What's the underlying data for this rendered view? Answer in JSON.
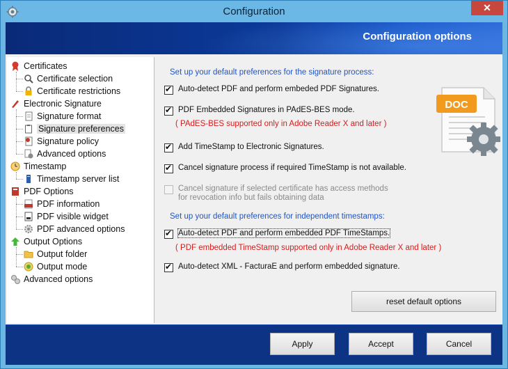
{
  "window": {
    "title": "Configuration"
  },
  "banner": {
    "title": "Configuration options"
  },
  "tree": {
    "items": [
      {
        "label": "Certificates",
        "level": 0,
        "icon": "ribbon-icon"
      },
      {
        "label": "Certificate selection",
        "level": 1,
        "icon": "magnifier-icon"
      },
      {
        "label": "Certificate restrictions",
        "level": 1,
        "icon": "lock-icon"
      },
      {
        "label": "Electronic Signature",
        "level": 0,
        "icon": "pen-icon"
      },
      {
        "label": "Signature format",
        "level": 1,
        "icon": "document-icon"
      },
      {
        "label": "Signature preferences",
        "level": 1,
        "icon": "clipboard-icon",
        "selected": true
      },
      {
        "label": "Signature policy",
        "level": 1,
        "icon": "policy-icon"
      },
      {
        "label": "Advanced options",
        "level": 1,
        "icon": "gear-doc-icon"
      },
      {
        "label": "Timestamp",
        "level": 0,
        "icon": "clock-icon"
      },
      {
        "label": "Timestamp server list",
        "level": 1,
        "icon": "server-icon"
      },
      {
        "label": "PDF Options",
        "level": 0,
        "icon": "pdf-book-icon"
      },
      {
        "label": "PDF information",
        "level": 1,
        "icon": "pdf-icon"
      },
      {
        "label": "PDF visible widget",
        "level": 1,
        "icon": "widget-icon"
      },
      {
        "label": "PDF advanced options",
        "level": 1,
        "icon": "gear-icon"
      },
      {
        "label": "Output Options",
        "level": 0,
        "icon": "arrow-up-icon"
      },
      {
        "label": "Output folder",
        "level": 1,
        "icon": "folder-icon"
      },
      {
        "label": "Output mode",
        "level": 1,
        "icon": "mode-icon"
      },
      {
        "label": "Advanced options",
        "level": 0,
        "icon": "gears-icon"
      }
    ]
  },
  "panel": {
    "section1_label": "Set up your default preferences for the signature process:",
    "section2_label": "Set up your default preferences for independent timestamps:",
    "options": {
      "auto_detect_pdf": {
        "label": "Auto-detect PDF and perform embeded PDF Signatures.",
        "checked": true
      },
      "pades_bes": {
        "label": "PDF Embedded Signatures in PAdES-BES mode.",
        "checked": true
      },
      "pades_note": "( PAdES-BES supported only in Adobe Reader X and later )",
      "add_timestamp": {
        "label": "Add TimeStamp to Electronic Signatures.",
        "checked": true
      },
      "cancel_if_timestamp": {
        "label": "Cancel signature process if required TimeStamp is not available.",
        "checked": true
      },
      "cancel_revocation_line1": "Cancel signature if selected certificate has access methods",
      "cancel_revocation_line2": "for revocation info but fails obtaining data",
      "auto_detect_timestamps": {
        "label": "Auto-detect PDF and perform embedded PDF TimeStamps.",
        "checked": true
      },
      "timestamps_note": "( PDF embedded TimeStamp supported only in Adobe Reader X and later )",
      "auto_detect_xml": {
        "label": "Auto-detect XML - FacturaE and perform embedded signature.",
        "checked": true
      }
    },
    "illustration_text": "DOC",
    "reset_label": "reset default options"
  },
  "footer": {
    "apply_label": "Apply",
    "accept_label": "Accept",
    "cancel_label": "Cancel"
  },
  "colors": {
    "banner": "#0b3a9a",
    "accent_text": "#1e54c8",
    "note_text": "#d81b1b"
  }
}
